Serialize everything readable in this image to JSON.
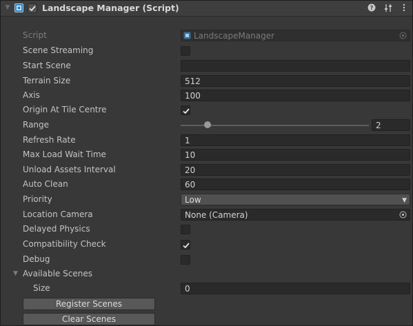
{
  "header": {
    "title": "Landscape Manager (Script)",
    "enabled": true,
    "icons": [
      "script-icon",
      "help-icon",
      "presets-icon",
      "context-menu-icon"
    ]
  },
  "script_row": {
    "label": "Script",
    "value": "LandscapeManager"
  },
  "fields": {
    "scene_streaming": {
      "label": "Scene Streaming",
      "checked": false
    },
    "start_scene": {
      "label": "Start Scene",
      "value": ""
    },
    "terrain_size": {
      "label": "Terrain Size",
      "value": "512"
    },
    "axis": {
      "label": "Axis",
      "value": "100"
    },
    "origin_at_tile_centre": {
      "label": "Origin At Tile Centre",
      "checked": true
    },
    "range": {
      "label": "Range",
      "value": "2"
    },
    "refresh_rate": {
      "label": "Refresh Rate",
      "value": "1"
    },
    "max_load_wait_time": {
      "label": "Max Load Wait Time",
      "value": "10"
    },
    "unload_assets_interval": {
      "label": "Unload Assets Interval",
      "value": "20"
    },
    "auto_clean": {
      "label": "Auto Clean",
      "value": "60"
    },
    "priority": {
      "label": "Priority",
      "value": "Low"
    },
    "location_camera": {
      "label": "Location Camera",
      "value": "None (Camera)"
    },
    "delayed_physics": {
      "label": "Delayed Physics",
      "checked": false
    },
    "compatibility_check": {
      "label": "Compatibility Check",
      "checked": true
    },
    "debug": {
      "label": "Debug",
      "checked": false
    }
  },
  "available_scenes": {
    "label": "Available Scenes",
    "expanded": true,
    "size_label": "Size",
    "size_value": "0"
  },
  "buttons": {
    "register": "Register Scenes",
    "clear": "Clear Scenes"
  },
  "colors": {
    "panel": "#383838",
    "header": "#3e3e3e",
    "field": "#2a2a2a",
    "text": "#c4c4c4",
    "button": "#585858"
  }
}
